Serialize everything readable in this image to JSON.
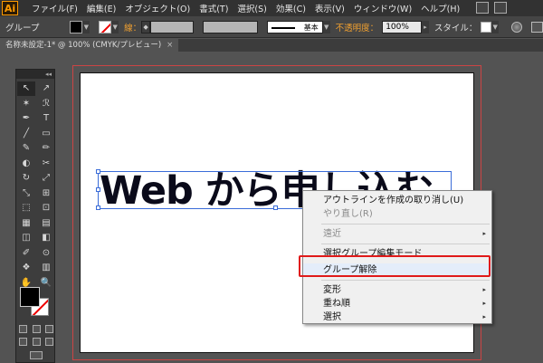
{
  "app": {
    "logo": "Ai"
  },
  "menu": [
    "ファイル(F)",
    "編集(E)",
    "オブジェクト(O)",
    "書式(T)",
    "選択(S)",
    "効果(C)",
    "表示(V)",
    "ウィンドウ(W)",
    "ヘルプ(H)"
  ],
  "control_bar": {
    "selection_label": "グループ",
    "stroke_label": "線：",
    "stroke_profile": "基本",
    "opacity_label": "不透明度：",
    "opacity_value": "100%",
    "style_label": "スタイル："
  },
  "document_tab": {
    "title": "名称未設定-1* @ 100% (CMYK/プレビュー)",
    "close": "×"
  },
  "tools_panel": {
    "header": "◂◂",
    "tools": [
      "↖",
      "↗",
      "✶",
      "ℛ",
      "✒",
      "T",
      "╱",
      "▭",
      "✎",
      "✏",
      "◐",
      "✂",
      "↻",
      "⤢",
      "⤡",
      "⊞",
      "⬚",
      "⊡",
      "▦",
      "▤",
      "◫",
      "◧",
      "✐",
      "⊙",
      "❖",
      "▥",
      "✋",
      "🔍"
    ]
  },
  "canvas": {
    "text": "Web から申し込む"
  },
  "context_menu": {
    "items": [
      {
        "label": "アウトラインを作成の取り消し(U)",
        "enabled": true,
        "submenu": false
      },
      {
        "label": "やり直し(R)",
        "enabled": false,
        "submenu": false
      },
      {
        "label": "遠近",
        "enabled": false,
        "submenu": true
      },
      {
        "label": "選択グループ編集モード",
        "enabled": true,
        "submenu": false
      },
      {
        "label": "グループ解除",
        "enabled": true,
        "submenu": false,
        "highlighted": true
      },
      {
        "label": "変形",
        "enabled": true,
        "submenu": true
      },
      {
        "label": "重ね順",
        "enabled": true,
        "submenu": true
      },
      {
        "label": "選択",
        "enabled": true,
        "submenu": true
      }
    ],
    "submenu_arrow": "▸"
  },
  "colors": {
    "highlight_frame": "#e01a1a",
    "selection": "#3a6cd8",
    "ui_dark": "#323232",
    "ui_panel": "#535353"
  }
}
